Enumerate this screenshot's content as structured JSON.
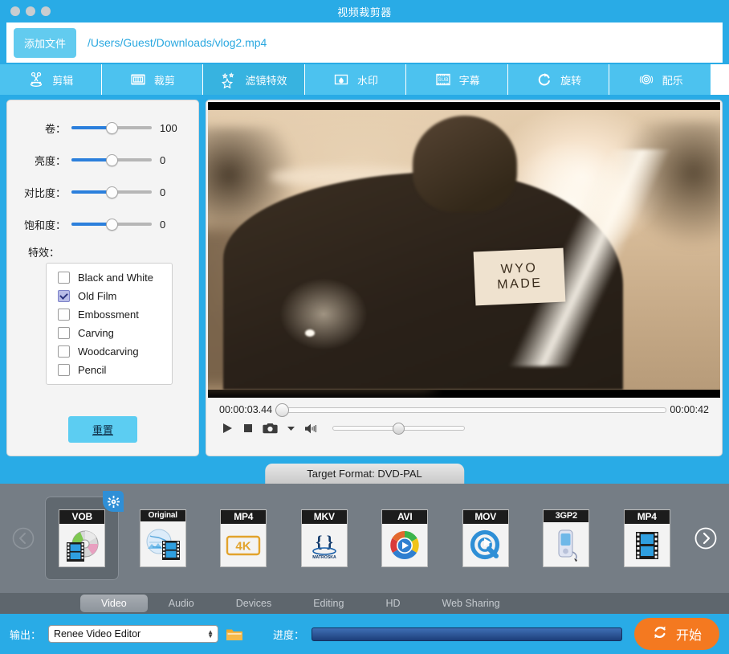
{
  "window": {
    "title": "视频裁剪器",
    "traffic_lights": [
      "close",
      "minimize",
      "maximize"
    ]
  },
  "filebar": {
    "add_file_label": "添加文件",
    "file_path": "/Users/Guest/Downloads/vlog2.mp4"
  },
  "toolbar": {
    "tabs": [
      {
        "label": "剪辑",
        "icon": "scissors-icon",
        "active": false
      },
      {
        "label": "裁剪",
        "icon": "crop-icon",
        "active": false
      },
      {
        "label": "滤镜特效",
        "icon": "star-effects-icon",
        "active": true
      },
      {
        "label": "水印",
        "icon": "watermark-icon",
        "active": false
      },
      {
        "label": "字幕",
        "icon": "subtitle-icon",
        "active": false
      },
      {
        "label": "旋转",
        "icon": "rotate-icon",
        "active": false
      },
      {
        "label": "配乐",
        "icon": "audio-disc-icon",
        "active": false
      }
    ]
  },
  "effects_panel": {
    "sliders": [
      {
        "label": "卷：",
        "value": "100",
        "percent": 50
      },
      {
        "label": "亮度：",
        "value": "0",
        "percent": 50
      },
      {
        "label": "对比度：",
        "value": "0",
        "percent": 50
      },
      {
        "label": "饱和度：",
        "value": "0",
        "percent": 50
      }
    ],
    "effects_label": "特效：",
    "effects": [
      {
        "label": "Black and White",
        "checked": false
      },
      {
        "label": "Old Film",
        "checked": true
      },
      {
        "label": "Embossment",
        "checked": false
      },
      {
        "label": "Carving",
        "checked": false
      },
      {
        "label": "Woodcarving",
        "checked": false
      },
      {
        "label": "Pencil",
        "checked": false
      }
    ],
    "reset_label": "重置"
  },
  "preview": {
    "patch_line1": "WYO",
    "patch_line2": "MADE",
    "current_time": "00:00:03.44",
    "total_time": "00:00:42",
    "timeline_percent": 1.5,
    "volume_percent": 50,
    "controls": [
      {
        "name": "play-button",
        "icon": "play-icon"
      },
      {
        "name": "stop-button",
        "icon": "stop-icon"
      },
      {
        "name": "snapshot-button",
        "icon": "camera-icon"
      },
      {
        "name": "snapshot-menu-button",
        "icon": "chevron-down-icon"
      },
      {
        "name": "volume-button",
        "icon": "speaker-icon"
      }
    ]
  },
  "format_section": {
    "tab_label": "Target Format: DVD-PAL",
    "prev_label": "‹",
    "next_label": "›",
    "items": [
      {
        "name": "VOB",
        "badge": "gear",
        "art": "disc-film",
        "selected": true
      },
      {
        "name": "Original",
        "badge": "",
        "art": "globe-film",
        "selected": false
      },
      {
        "name": "MP4",
        "badge": "",
        "art": "4k",
        "selected": false
      },
      {
        "name": "MKV",
        "badge": "",
        "art": "matroska",
        "selected": false
      },
      {
        "name": "AVI",
        "badge": "",
        "art": "color-wheel",
        "selected": false
      },
      {
        "name": "MOV",
        "badge": "",
        "art": "quicktime",
        "selected": false
      },
      {
        "name": "3GP2",
        "badge": "",
        "art": "phone",
        "selected": false
      },
      {
        "name": "MP4",
        "badge": "",
        "art": "film",
        "selected": false
      }
    ],
    "categories": [
      {
        "label": "Video",
        "active": true
      },
      {
        "label": "Audio",
        "active": false
      },
      {
        "label": "Devices",
        "active": false
      },
      {
        "label": "Editing",
        "active": false
      },
      {
        "label": "HD",
        "active": false
      },
      {
        "label": "Web Sharing",
        "active": false
      }
    ]
  },
  "bottom_bar": {
    "output_label": "输出：",
    "output_value": "Renee Video Editor",
    "folder_icon": "folder-icon",
    "progress_label": "进度：",
    "progress_percent": 0,
    "start_label": "开始",
    "start_icon": "refresh-icon"
  },
  "colors": {
    "brand_blue": "#29abe6",
    "tab_blue": "#4cc2ef",
    "tab_active_blue": "#37b3e0",
    "accent_orange": "#f47920",
    "panel_grey": "#757d85",
    "slider_blue": "#2b7fdc"
  }
}
